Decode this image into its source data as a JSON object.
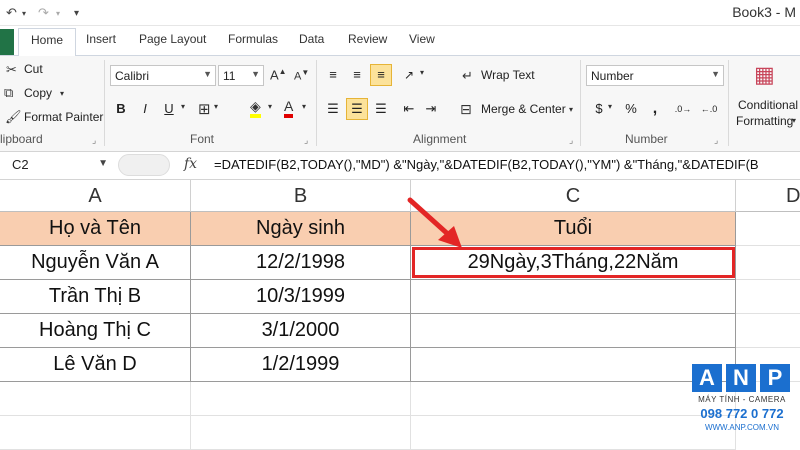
{
  "title": "Book3 - M",
  "ribbon_tabs": [
    "Home",
    "Insert",
    "Page Layout",
    "Formulas",
    "Data",
    "Review",
    "View"
  ],
  "clipboard": {
    "cut": "Cut",
    "copy": "Copy",
    "format_painter": "Format Painter",
    "label": "lipboard"
  },
  "font": {
    "name": "Calibri",
    "size": "11",
    "label": "Font",
    "bold": "B",
    "italic": "I",
    "underline": "U"
  },
  "alignment": {
    "wrap_text": "Wrap Text",
    "merge_center": "Merge & Center",
    "label": "Alignment"
  },
  "number": {
    "format": "Number",
    "label": "Number",
    "currency": "$",
    "percent": "%",
    "comma": ","
  },
  "styles": {
    "conditional_formatting_line1": "Conditional",
    "conditional_formatting_line2": "Formatting"
  },
  "formula_bar": {
    "name_box": "C2",
    "fx": "fx",
    "formula": "=DATEDIF(B2,TODAY(),\"MD\") &\"Ngày,\"&DATEDIF(B2,TODAY(),\"YM\") &\"Tháng,\"&DATEDIF(B"
  },
  "columns": [
    "A",
    "B",
    "C",
    "D"
  ],
  "table": {
    "headers": [
      "Họ và Tên",
      "Ngày sinh",
      "Tuổi"
    ],
    "rows": [
      [
        "Nguyễn Văn A",
        "12/2/1998",
        "29Ngày,3Tháng,22Năm"
      ],
      [
        "Trần Thị B",
        "10/3/1999",
        ""
      ],
      [
        "Hoàng Thị C",
        "3/1/2000",
        ""
      ],
      [
        "Lê Văn D",
        "1/2/1999",
        ""
      ]
    ]
  },
  "watermark": {
    "letters": [
      "A",
      "N",
      "P"
    ],
    "tagline": "MÁY TÍNH - CAMERA",
    "phone": "098 772 0 772",
    "website": "WWW.ANP.COM.VN"
  },
  "colors": {
    "header_fill": "#f9ceb0",
    "selection_border": "#e32626",
    "arrow": "#e32626",
    "brand_green": "#217346",
    "anp_blue": "#1b6fcf"
  }
}
